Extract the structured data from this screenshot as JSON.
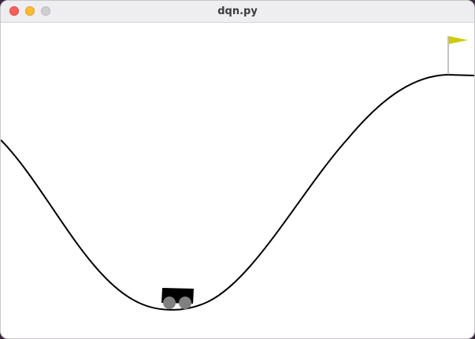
{
  "window": {
    "title": "dqn.py",
    "controls": [
      "close",
      "minimize",
      "maximize"
    ]
  },
  "scene": {
    "environment": "mountain-car",
    "objects": [
      "track-curve",
      "car",
      "goal-flag"
    ],
    "colors": {
      "background": "#ffffff",
      "track": "#000000",
      "car_body": "#000000",
      "wheels": "#808080",
      "flag": "#cccc00",
      "flagpole": "#999999"
    }
  }
}
